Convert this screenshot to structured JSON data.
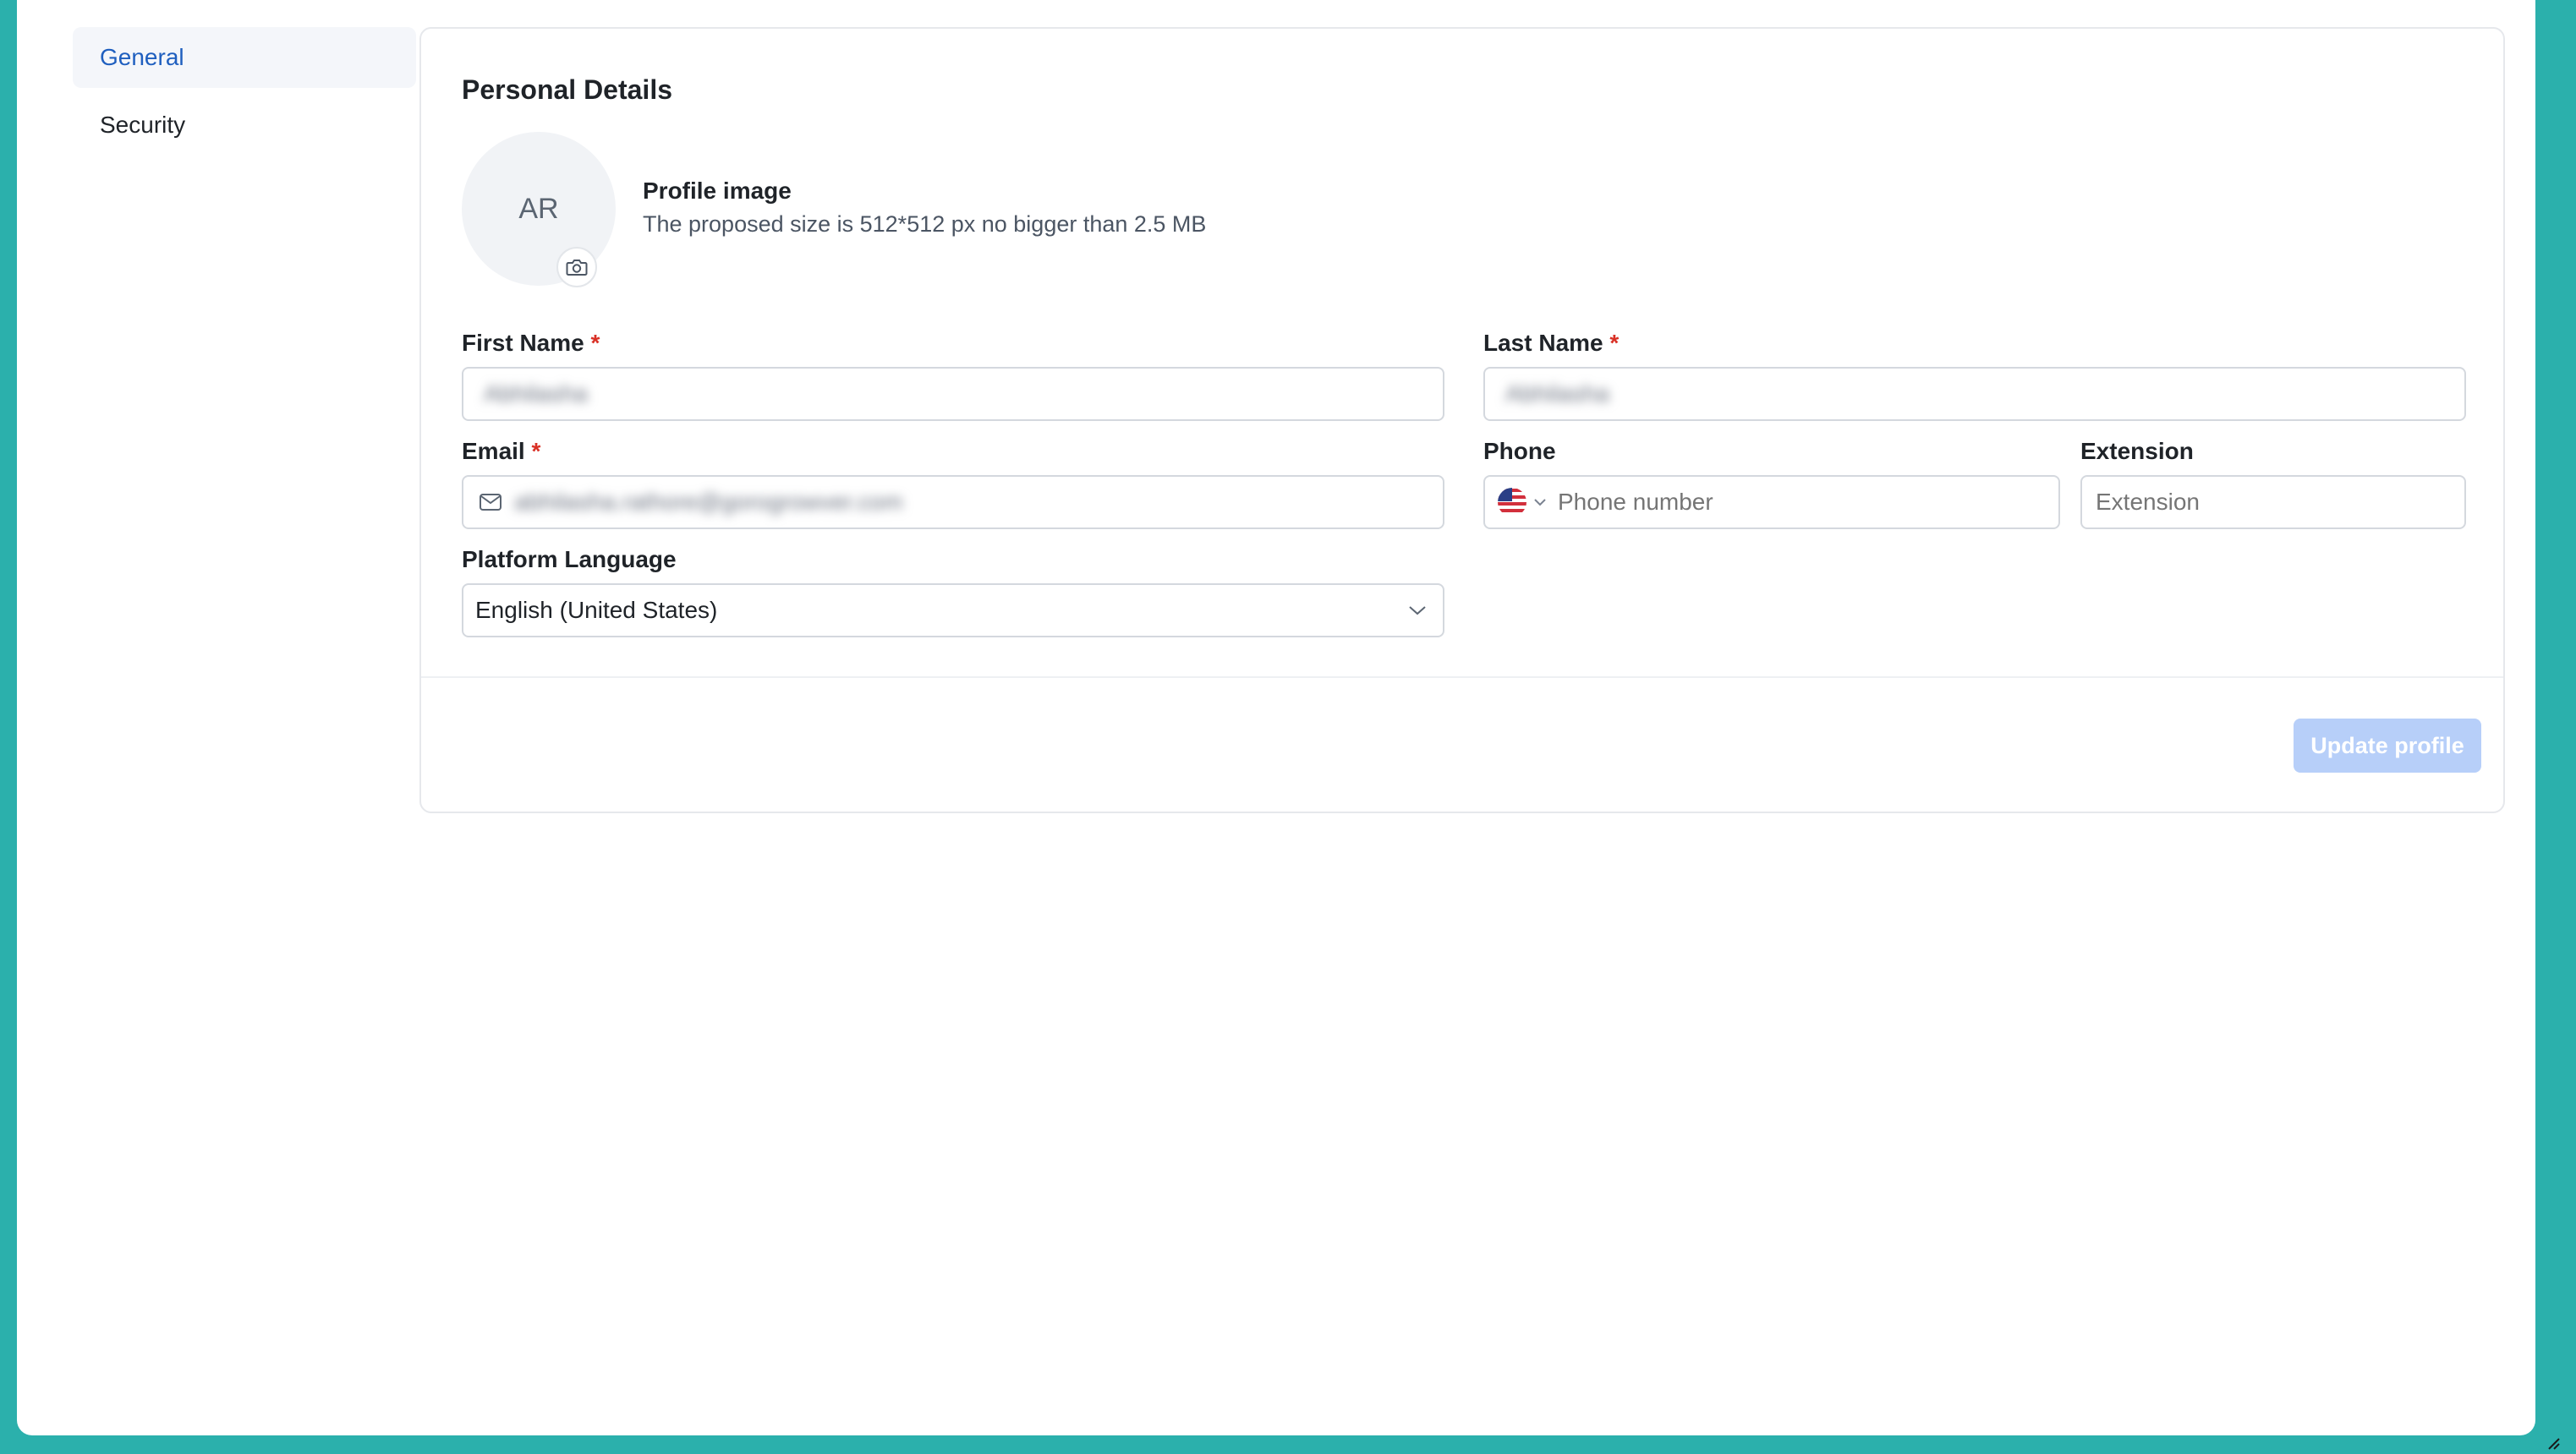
{
  "sidebar": {
    "items": [
      {
        "label": "General",
        "active": true
      },
      {
        "label": "Security",
        "active": false
      }
    ]
  },
  "card": {
    "title": "Personal Details",
    "avatar_initials": "AR",
    "camera_icon": "camera-icon",
    "profile_image_label": "Profile image",
    "profile_image_hint": "The proposed size is 512*512 px no bigger than 2.5 MB"
  },
  "form": {
    "first_name": {
      "label": "First Name",
      "required": "*",
      "value": "Abhilasha"
    },
    "last_name": {
      "label": "Last Name",
      "required": "*",
      "value": "Abhilasha"
    },
    "email": {
      "label": "Email",
      "required": "*",
      "value": "abhilasha.rathore@gorogrowver.com",
      "icon": "mail-icon"
    },
    "phone": {
      "label": "Phone",
      "placeholder": "Phone number",
      "country_icon": "us-flag-icon",
      "chevron_icon": "chevron-down-icon"
    },
    "extension": {
      "label": "Extension",
      "placeholder": "Extension"
    },
    "language": {
      "label": "Platform Language",
      "value": "English (United States)",
      "chevron_icon": "chevron-down-icon"
    }
  },
  "actions": {
    "update_label": "Update profile"
  },
  "colors": {
    "frame": "#2bb0ac",
    "accent": "#1f5fbf",
    "required": "#d93025",
    "button_disabled": "#b7cff9"
  }
}
